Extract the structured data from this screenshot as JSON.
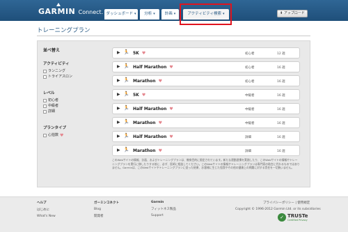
{
  "header": {
    "logo": "GARMIN",
    "logo_suffix": "Connect.",
    "tabs": [
      {
        "label": "ダッシュボード"
      },
      {
        "label": "分析"
      },
      {
        "label": "計画"
      },
      {
        "label": "アクティビティ検索"
      }
    ],
    "upload_label": "アップロード",
    "colors": {
      "bar": "#1f4f7a",
      "highlight": "#e0141e"
    }
  },
  "page": {
    "title": "トレーニングプラン"
  },
  "sidebar": {
    "sort_label": "並べ替え",
    "groups": [
      {
        "heading": "アクティビティ",
        "options": [
          {
            "label": "ランニング"
          },
          {
            "label": "トライアスロン"
          }
        ]
      },
      {
        "heading": "レベル",
        "options": [
          {
            "label": "初心者"
          },
          {
            "label": "中級者"
          },
          {
            "label": "詳細"
          }
        ]
      },
      {
        "heading": "プランタイプ",
        "options": [
          {
            "label": "心拍数"
          }
        ]
      }
    ]
  },
  "plans": [
    {
      "name": "5K",
      "level": "初心者",
      "weeks": "12 週"
    },
    {
      "name": "Half Marathon",
      "level": "初心者",
      "weeks": "16 週"
    },
    {
      "name": "Marathon",
      "level": "初心者",
      "weeks": "16 週"
    },
    {
      "name": "5K",
      "level": "中級者",
      "weeks": "16 週"
    },
    {
      "name": "Half Marathon",
      "level": "中級者",
      "weeks": "16 週"
    },
    {
      "name": "Marathon",
      "level": "中級者",
      "weeks": "16 週"
    },
    {
      "name": "Half Marathon",
      "level": "詳細",
      "weeks": "16 週"
    },
    {
      "name": "Marathon",
      "level": "詳細",
      "weeks": "16 週"
    }
  ],
  "disclaimer": "このWebサイトの情報、計画、およびトレーニングプランは、教育目的に限定されています。新たな運動習慣を実践したり、このWebサイトの情報やトレーニングプランを実行に移したりする前に、必ず、医師に相談してください。このWebサイトの情報やトレーニングプランは専門家の助言に代わるものではありません。Garminは、このWebサイトやトレーニングプランに従った結果、お客様に生じた怪我やその他の健康上の問題に対する責任を一切負いません。",
  "footer": {
    "columns": [
      {
        "heading": "ヘルプ",
        "links": [
          "はじめに",
          "What's New"
        ]
      },
      {
        "heading": "ガーミンコネクト",
        "links": [
          "Blog",
          "開発者"
        ]
      },
      {
        "heading": "Garmin",
        "links": [
          "フィットネス製品",
          "Support"
        ]
      }
    ],
    "privacy": "プライバシーポリシー | 使用規定",
    "copyright": "Copyright © 1996-2012 Garmin Ltd. or its subsidiaries",
    "truste": {
      "word": "TRUSTe",
      "sub": "Certified Privacy"
    }
  }
}
